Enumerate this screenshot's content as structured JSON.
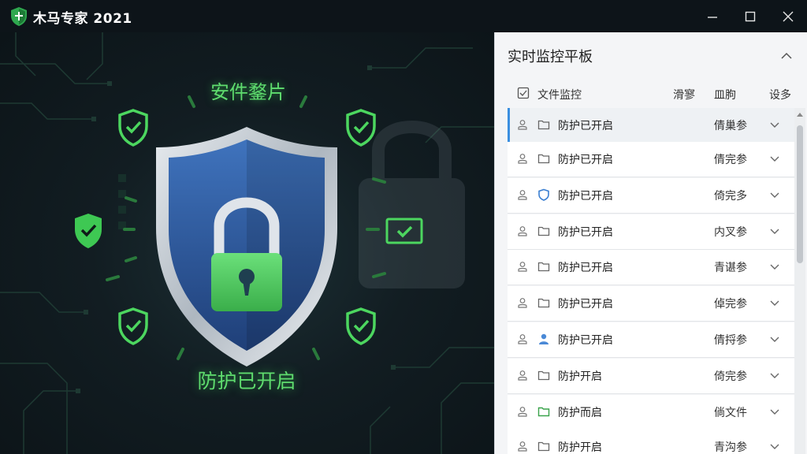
{
  "window": {
    "title": "木马专家 2021",
    "controls": [
      "minimize-icon",
      "maximize-icon",
      "close-icon"
    ]
  },
  "main": {
    "feature_label": "安件鍪片",
    "status_label": "防护已开启",
    "accent_color": "#5fdc6e",
    "shield_color": "#2f5fa3",
    "lock_color": "#4cc95c"
  },
  "panel": {
    "title": "实时监控平板",
    "columns": {
      "name": "文件监控",
      "col2": "滑寥",
      "col3": "皿朐",
      "col4": "设多"
    },
    "rows": [
      {
        "icon": "folder-icon",
        "label": "防护已开启",
        "value": "倩巢参",
        "selected": true
      },
      {
        "icon": "folder-icon",
        "label": "防护已开启",
        "value": "倩完参"
      },
      {
        "icon": "shield-icon",
        "label": "防护已开启",
        "value": "倚完多"
      },
      {
        "icon": "folder-icon",
        "label": "防护已开启",
        "value": "内叉参"
      },
      {
        "icon": "folder-icon",
        "label": "防护已开启",
        "value": "青谌参"
      },
      {
        "icon": "folder-icon",
        "label": "防护已开启",
        "value": "倬完参"
      },
      {
        "icon": "user-icon",
        "label": "防护已开启",
        "value": "倩捋参"
      },
      {
        "icon": "folder-icon",
        "label": "防护开启",
        "value": "倚完参"
      },
      {
        "icon": "folder-green-icon",
        "label": "防护而启",
        "value": "倘文件"
      },
      {
        "icon": "folder-icon",
        "label": "防护开启",
        "value": "青沟参"
      }
    ]
  }
}
